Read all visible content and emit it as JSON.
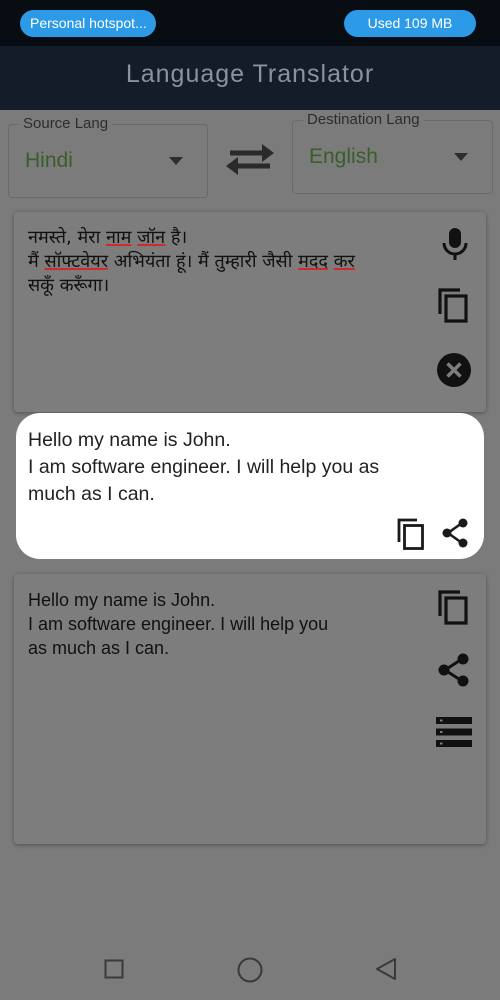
{
  "status_bar": {
    "hotspot_label": "Personal hotspot...",
    "data_usage": "Used  109 MB"
  },
  "app_bar": {
    "title": "Language Translator"
  },
  "source_lang": {
    "legend": "Source Lang",
    "selected": "Hindi"
  },
  "destination_lang": {
    "legend": "Destination Lang",
    "selected": "English"
  },
  "input": {
    "segments": [
      {
        "text": "नमस्ते, मेरा ",
        "spell_error": false
      },
      {
        "text": "नाम",
        "spell_error": true
      },
      {
        "text": " ",
        "spell_error": false
      },
      {
        "text": "जॉन",
        "spell_error": true
      },
      {
        "text": " है।\nमैं ",
        "spell_error": false
      },
      {
        "text": "सॉफ्टवेयर",
        "spell_error": true
      },
      {
        "text": " अभियंता हूं। मैं तुम्हारी जैसी ",
        "spell_error": false
      },
      {
        "text": "मदद",
        "spell_error": true
      },
      {
        "text": " ",
        "spell_error": false
      },
      {
        "text": "कर",
        "spell_error": true
      },
      {
        "text": "\nसकूँ करूँगा।",
        "spell_error": false
      }
    ]
  },
  "popup": {
    "lines": [
      "Hello my name is John.",
      "I am software engineer. I will help you as",
      "much as I can."
    ]
  },
  "output": {
    "lines": [
      "Hello my name is John.",
      "I am software engineer. I will help you",
      "as much as I can."
    ]
  },
  "icons": {
    "swap": "swap-arrows-icon",
    "mic": "microphone-icon",
    "copy": "copy-icon",
    "clear": "close-circle-icon",
    "share": "share-icon",
    "list": "list-icon",
    "nav_recent": "square-icon",
    "nav_home": "circle-icon",
    "nav_back": "triangle-back-icon"
  },
  "colors": {
    "status_pill": "#2d9ae8",
    "app_bar": "#141c2a",
    "lang_value": "#3a5e2a",
    "spell_underline": "#d12a2a"
  }
}
